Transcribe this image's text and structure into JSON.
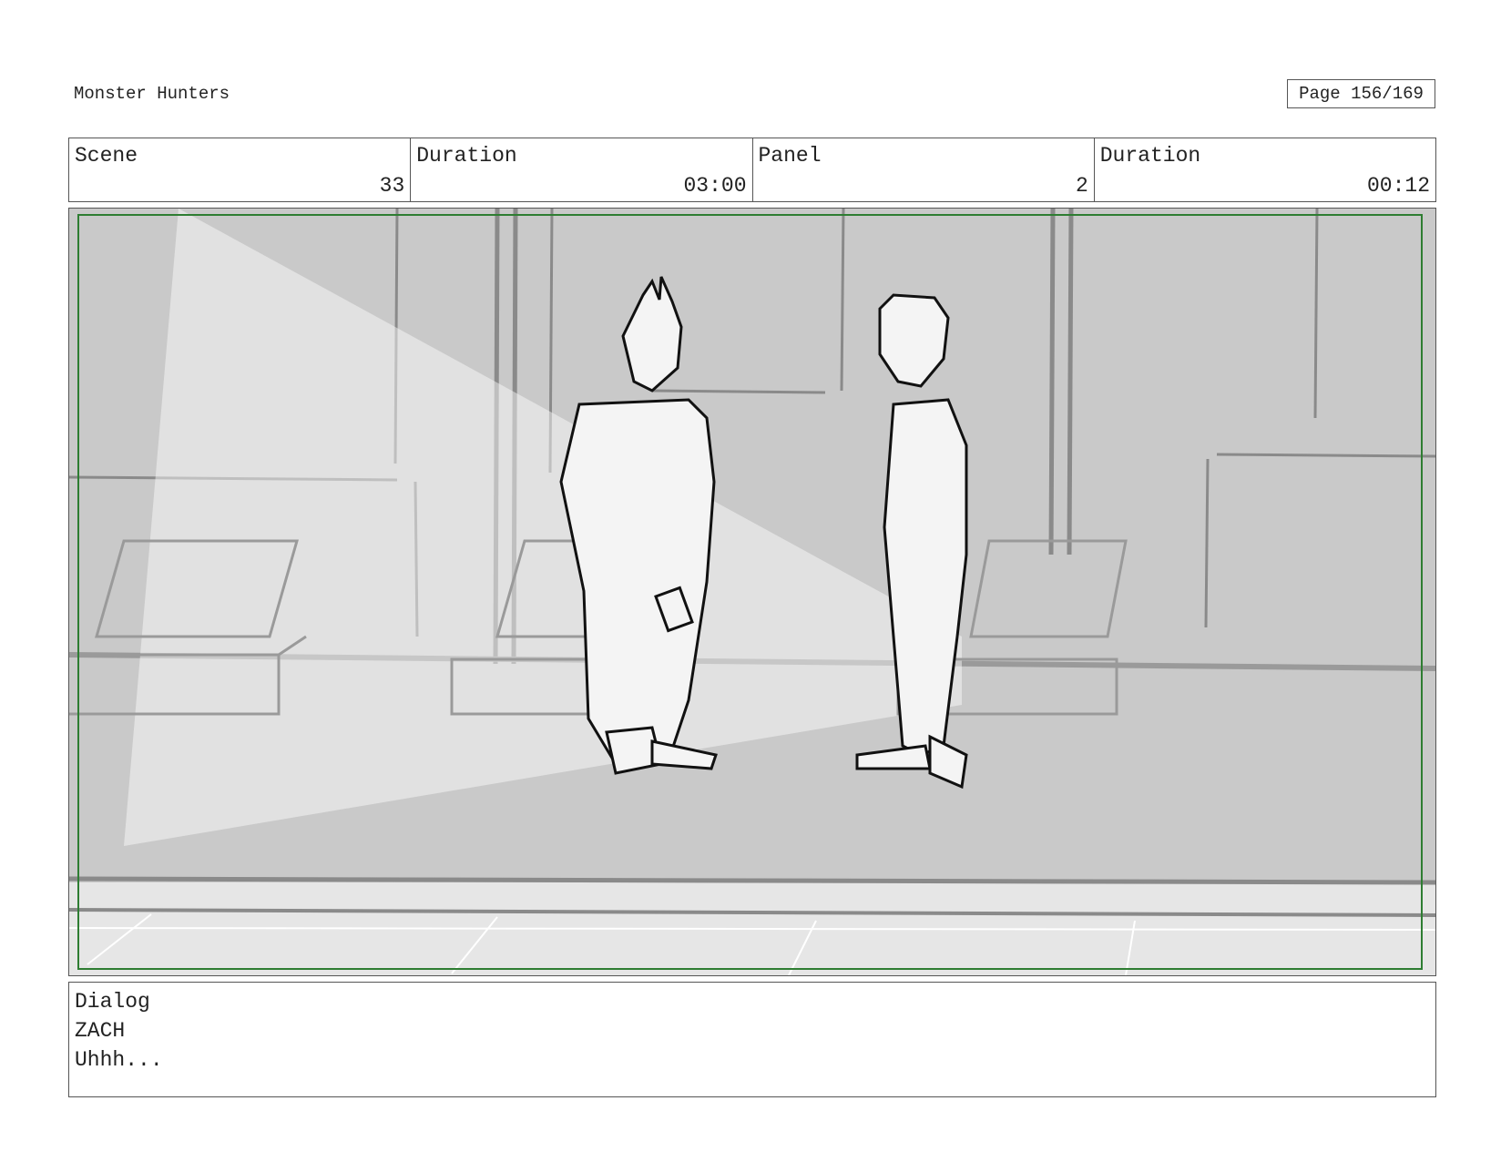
{
  "document": {
    "title": "Monster Hunters",
    "page_indicator": "Page 156/169"
  },
  "header": {
    "cells": [
      {
        "label": "Scene",
        "value": "33"
      },
      {
        "label": "Duration",
        "value": "03:00"
      },
      {
        "label": "Panel",
        "value": "2"
      },
      {
        "label": "Duration",
        "value": "00:12"
      }
    ]
  },
  "panel": {
    "frame_color": "#2e7d32",
    "icons": [
      "storyboard-sketch"
    ]
  },
  "dialog": {
    "label": "Dialog",
    "speaker": "ZACH",
    "line": "Uhhh..."
  }
}
